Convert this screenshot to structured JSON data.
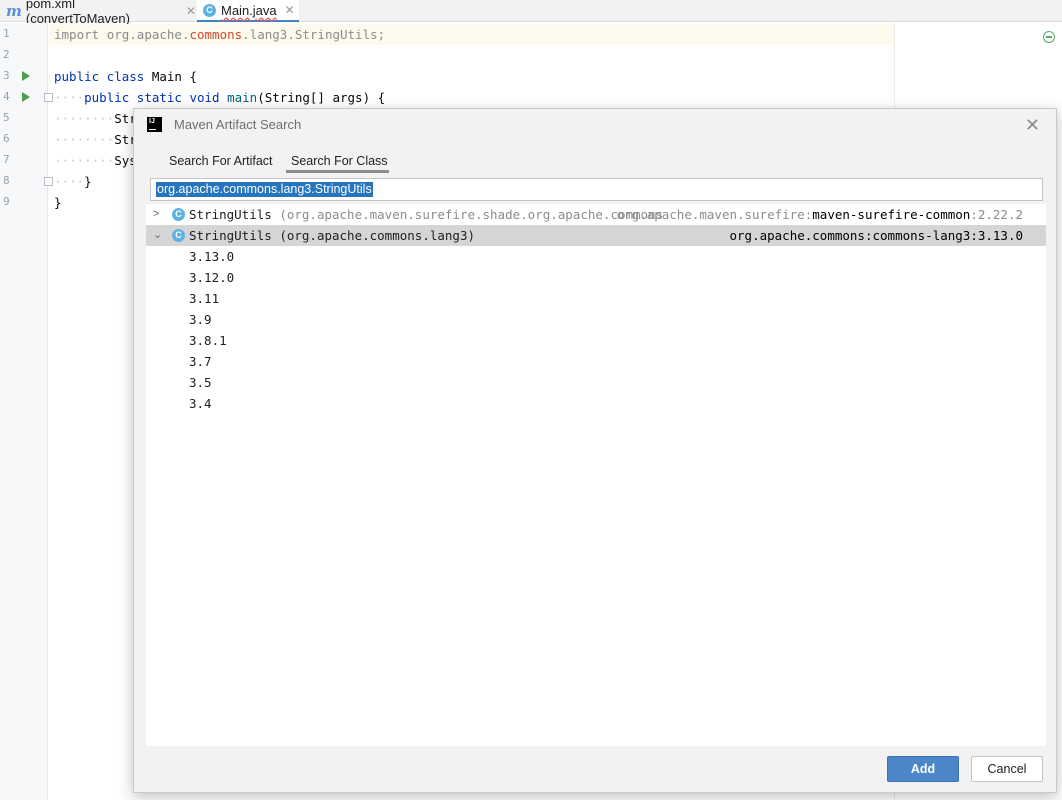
{
  "tabs": [
    {
      "label": "pom.xml (convertToMaven)",
      "icon": "maven-file-icon"
    },
    {
      "label": "Main.java",
      "icon": "java-class-icon",
      "active": true
    }
  ],
  "editor": {
    "line_numbers": [
      "1",
      "2",
      "3",
      "4",
      "5",
      "6",
      "7",
      "8",
      "9"
    ],
    "lines": {
      "l1_kw": "import ",
      "l1_a": "org.apache.",
      "l1_err": "commons",
      "l1_b": ".lang3.StringUtils;",
      "l3_kw": "public class ",
      "l3_rest": "Main {",
      "l4_kw": "public static void ",
      "l4_fn": "main",
      "l4_rest": "(String[] args) {",
      "l5": "Stri",
      "l6": "Stri",
      "l7": "Syst",
      "l8": "}",
      "l9": "}"
    }
  },
  "dialog": {
    "title": "Maven Artifact Search",
    "tabs": [
      "Search For Artifact",
      "Search For Class"
    ],
    "active_tab": "Search For Class",
    "search_value": "org.apache.commons.lang3.StringUtils",
    "results": [
      {
        "class": "StringUtils",
        "package": "(org.apache.maven.surefire.shade.org.apache.commons",
        "group": "org.apache.maven.surefire:",
        "artifact": "maven-surefire-common",
        "version": ":2.22.2",
        "expanded": false
      },
      {
        "class": "StringUtils",
        "package": "(org.apache.commons.lang3)",
        "coordinates": "org.apache.commons:commons-lang3:3.13.0",
        "expanded": true,
        "versions": [
          "3.13.0",
          "3.12.0",
          "3.11",
          "3.9",
          "3.8.1",
          "3.7",
          "3.5",
          "3.4"
        ]
      }
    ],
    "buttons": {
      "add": "Add",
      "cancel": "Cancel"
    }
  },
  "colors": {
    "accent": "#4a86c8",
    "selection": "#2675bf",
    "keyword": "#0033b3",
    "error": "#d14a2f"
  }
}
